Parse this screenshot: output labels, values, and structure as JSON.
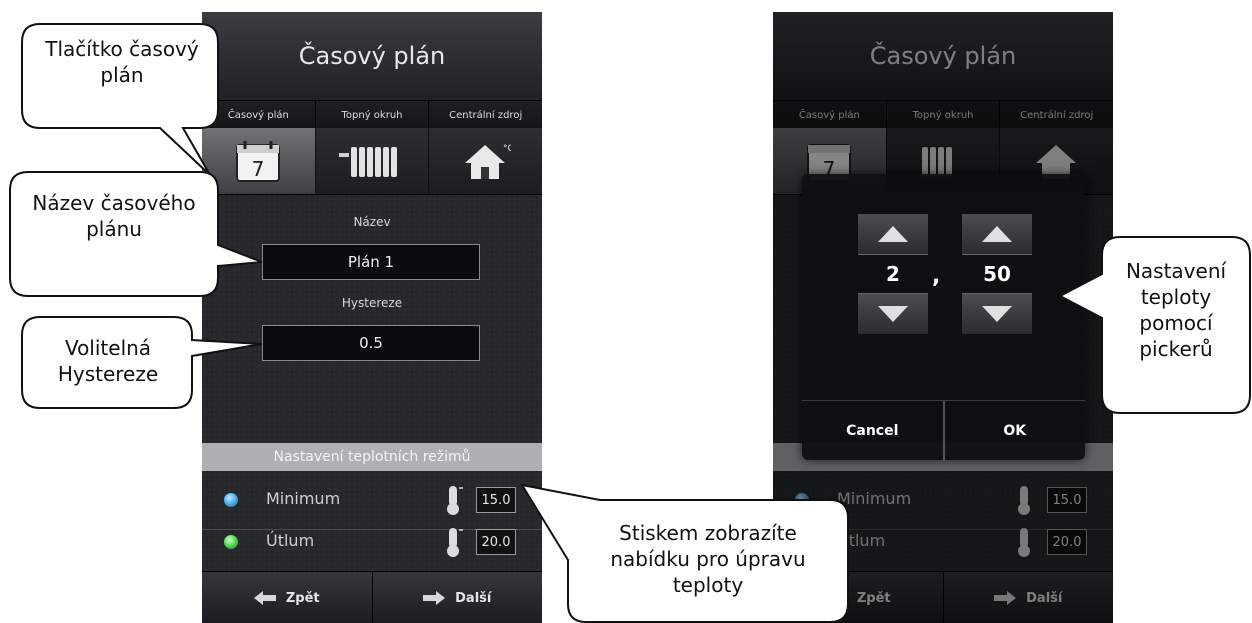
{
  "left_screen": {
    "title": "Časový plán",
    "tabs": [
      "Časový plán",
      "Topný okruh",
      "Centrální zdroj"
    ],
    "active_tab_index": 0,
    "calendar_icon_day": "7",
    "name_label": "Název",
    "name_value": "Plán 1",
    "hysteresis_label": "Hystereze",
    "hysteresis_value": "0.5",
    "section_header": "Nastavení teplotních režimů",
    "modes": [
      {
        "label": "Minimum",
        "value": "15.0",
        "dot_color": "#3fa7e6"
      },
      {
        "label": "Útlum",
        "value": "20.0",
        "dot_color": "#3fd23f"
      }
    ],
    "back_label": "Zpět",
    "next_label": "Další"
  },
  "right_screen": {
    "title": "Časový plán",
    "tabs": [
      "Časový plán",
      "Topný okruh",
      "Centrální zdroj"
    ],
    "calendar_icon_day": "7",
    "modes": [
      {
        "label": "Minimum",
        "value": "15.0"
      },
      {
        "label": "Útlum",
        "value": "20.0"
      }
    ],
    "back_label": "Zpět",
    "next_label": "Další",
    "picker": {
      "integer_value": "2",
      "separator": ",",
      "decimal_value": "50",
      "cancel_label": "Cancel",
      "ok_label": "OK"
    }
  },
  "callouts": {
    "schedule_button": "Tlačítko časový plán",
    "schedule_name": "Název časového plánu",
    "hysteresis": "Volitelná Hystereze",
    "temperature_edit": "Stiskem zobrazíte nabídku pro úpravu teploty",
    "picker_info": "Nastavení teploty pomocí pickerů"
  },
  "colors": {
    "accent_blue": "#3fa7e6",
    "accent_green": "#3fd23f",
    "section_header_bg": "#aeb0b2"
  }
}
